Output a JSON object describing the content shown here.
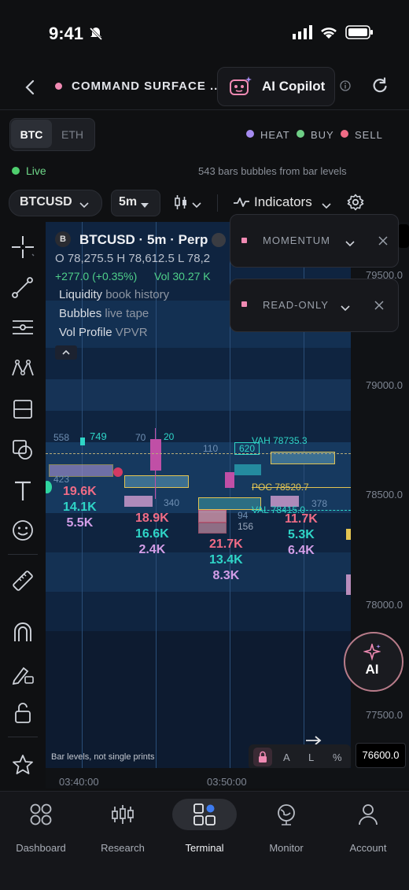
{
  "status_bar": {
    "time": "9:41"
  },
  "header": {
    "title": "COMMAND SURFACE ...",
    "copilot_label": "AI Copilot"
  },
  "asset_tabs": [
    "BTC",
    "ETH"
  ],
  "legend": [
    "HEAT",
    "BUY",
    "SELL"
  ],
  "live": {
    "label": "Live",
    "info": "543 bars  bubbles from bar levels"
  },
  "toolbar": {
    "symbol": "BTCUSD",
    "interval": "5m",
    "indicators": "Indicators"
  },
  "chart": {
    "header_badge": "B",
    "header_title": "BTCUSD · 5m · Perp",
    "ohlc_line": "O 78,275.5  H 78,612.5  L 78,2",
    "change_line": "+277.0 (+0.35%)",
    "vol_line": "Vol 30.27 K",
    "layers": [
      {
        "name": "Liquidity",
        "sub": "book history"
      },
      {
        "name": "Bubbles",
        "sub": "live tape"
      },
      {
        "name": "Vol Profile",
        "sub": "VPVR"
      }
    ],
    "clusters": [
      {
        "a": "19.6K",
        "b": "14.1K",
        "c": "5.5K"
      },
      {
        "a": "18.9K",
        "b": "16.6K",
        "c": "2.4K"
      },
      {
        "a": "21.7K",
        "b": "13.4K",
        "c": "8.3K"
      },
      {
        "a": "11.7K",
        "b": "5.3K",
        "c": "6.4K"
      }
    ],
    "small_values": [
      "558",
      "749",
      "70",
      "20",
      "110",
      "620",
      "423",
      "340",
      "94",
      "156",
      "378"
    ],
    "vah_label": "VAH 78735.3",
    "poc_label": "POC 78520.7",
    "val_label": "VAL 78415.0",
    "footnote": "Bar levels, not single prints",
    "time_labels": [
      "03:40:00",
      "03:50:00",
      "0"
    ],
    "scale_buttons": [
      "A",
      "L",
      "%"
    ]
  },
  "popups": [
    {
      "label": "MOMENTUM"
    },
    {
      "label": "READ-ONLY"
    }
  ],
  "price_axis": {
    "labels": [
      "79500.0",
      "79000.0",
      "78500.0",
      "78000.0",
      "77500.0"
    ],
    "current_price": "76600.0"
  },
  "ai_fab": {
    "label": "AI"
  },
  "bottom_nav": [
    {
      "label": "Dashboard",
      "icon": "dashboard-icon"
    },
    {
      "label": "Research",
      "icon": "research-icon"
    },
    {
      "label": "Terminal",
      "icon": "terminal-icon"
    },
    {
      "label": "Monitor",
      "icon": "monitor-icon"
    },
    {
      "label": "Account",
      "icon": "account-icon"
    }
  ],
  "colors": {
    "accent_pink": "#f08ab3",
    "heat": "#a58bf0",
    "buy": "#6fcf86",
    "sell": "#f06c86",
    "teal": "#2fd5c7",
    "yellow": "#e6c452"
  }
}
